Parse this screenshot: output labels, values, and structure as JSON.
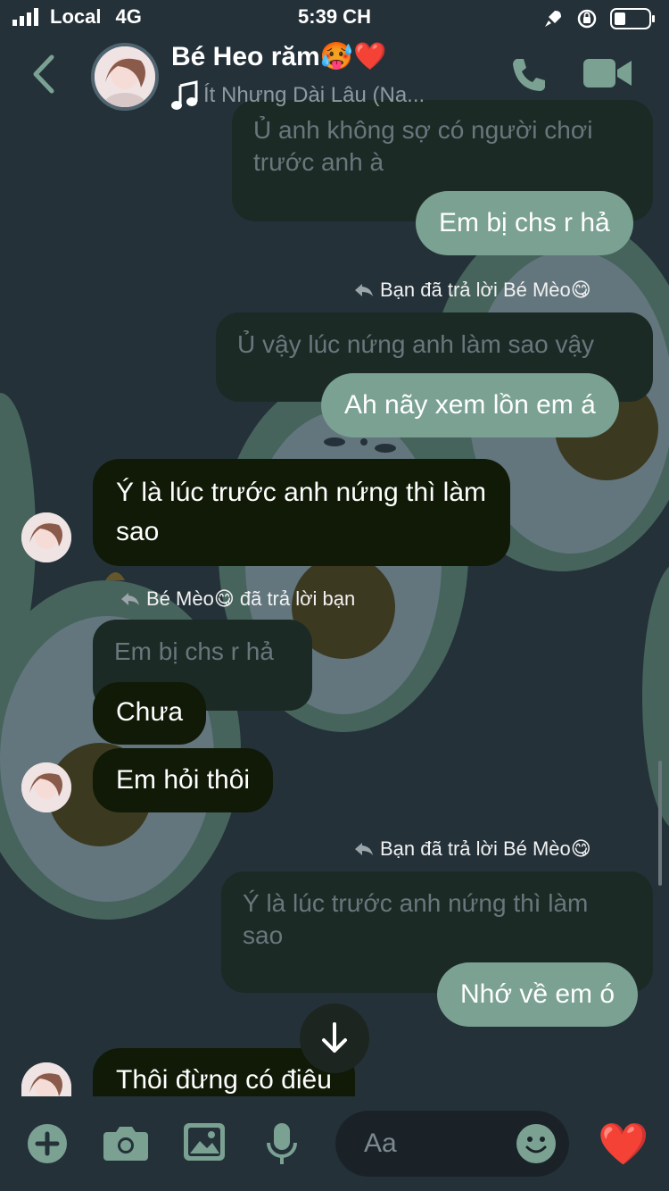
{
  "status_bar": {
    "carrier": "Local",
    "network": "4G",
    "time": "5:39 CH"
  },
  "header": {
    "contact_name": "Bé Heo răm🥵❤️",
    "now_playing": "Ít Nhưng Dài Lâu (Na..."
  },
  "messages": {
    "m1_quote": "Ủ anh không sợ có người chơi trước anh à",
    "m1_text": "Em bị chs r hả",
    "m2_reply_note": "Bạn đã trả lời Bé Mèo😋",
    "m2_quote": "Ủ vậy lúc nứng anh làm sao vậy",
    "m2_text": "Ah nãy xem lồn em á",
    "m3_text": "Ý là lúc trước anh nứng thì làm sao",
    "m4_reply_note": "Bé Mèo😋 đã trả lời bạn",
    "m4_quote": "Em bị chs r hả",
    "m4_text1": "Chưa",
    "m4_text2": "Em hỏi thôi",
    "m5_reply_note": "Bạn đã trả lời Bé Mèo😋",
    "m5_quote": "Ý là lúc trước anh nứng thì làm sao",
    "m5_text": "Nhớ về em ó",
    "m6_text": "Thôi đừng có điêu"
  },
  "composer": {
    "placeholder": "Aa",
    "like_emoji": "❤️"
  },
  "colors": {
    "background": "#243139",
    "outgoing_bubble": "#7aa192",
    "incoming_bubble": "#101a07",
    "accent": "#7aa192"
  }
}
